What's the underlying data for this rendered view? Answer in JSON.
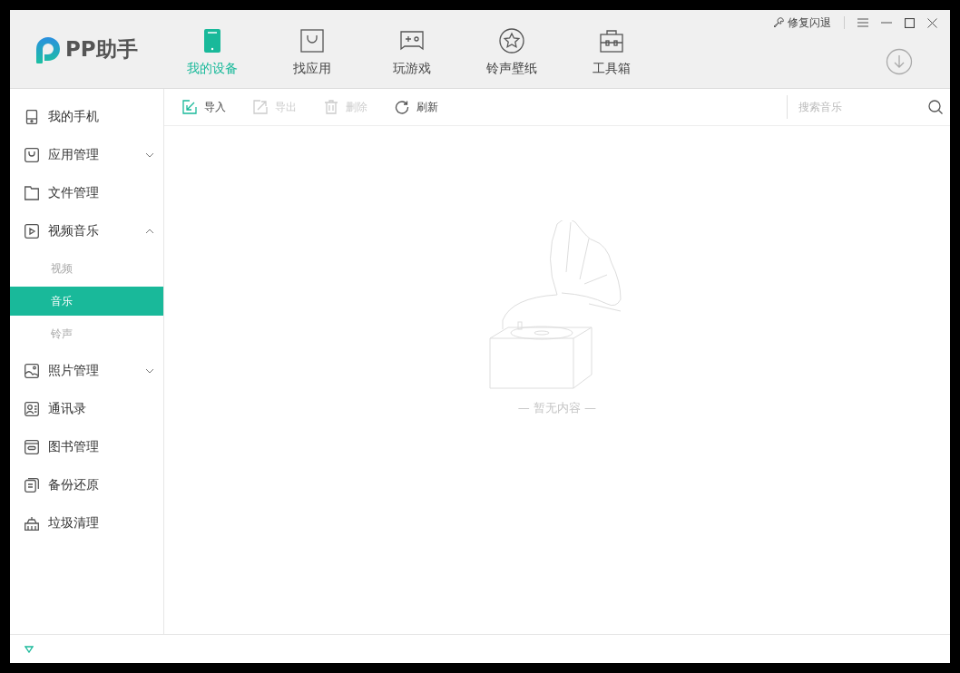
{
  "logo": {
    "text": "PP助手"
  },
  "tabs": [
    {
      "label": "我的设备",
      "selected": true
    },
    {
      "label": "找应用",
      "selected": false
    },
    {
      "label": "玩游戏",
      "selected": false
    },
    {
      "label": "铃声壁纸",
      "selected": false
    },
    {
      "label": "工具箱",
      "selected": false
    }
  ],
  "top_actions": {
    "repair": "修复闪退"
  },
  "sidebar": {
    "items": [
      {
        "label": "我的手机"
      },
      {
        "label": "应用管理",
        "expanded": false
      },
      {
        "label": "文件管理"
      },
      {
        "label": "视频音乐",
        "expanded": true,
        "children": [
          {
            "label": "视频",
            "selected": false
          },
          {
            "label": "音乐",
            "selected": true
          },
          {
            "label": "铃声",
            "selected": false
          }
        ]
      },
      {
        "label": "照片管理",
        "expanded": false
      },
      {
        "label": "通讯录"
      },
      {
        "label": "图书管理"
      },
      {
        "label": "备份还原"
      },
      {
        "label": "垃圾清理"
      }
    ]
  },
  "toolbar": {
    "buttons": [
      {
        "label": "导入",
        "disabled": false
      },
      {
        "label": "导出",
        "disabled": true
      },
      {
        "label": "删除",
        "disabled": true
      },
      {
        "label": "刷新",
        "disabled": false
      }
    ],
    "search": {
      "placeholder": "搜索音乐"
    }
  },
  "empty_state": {
    "text": "— 暂无内容 —"
  }
}
